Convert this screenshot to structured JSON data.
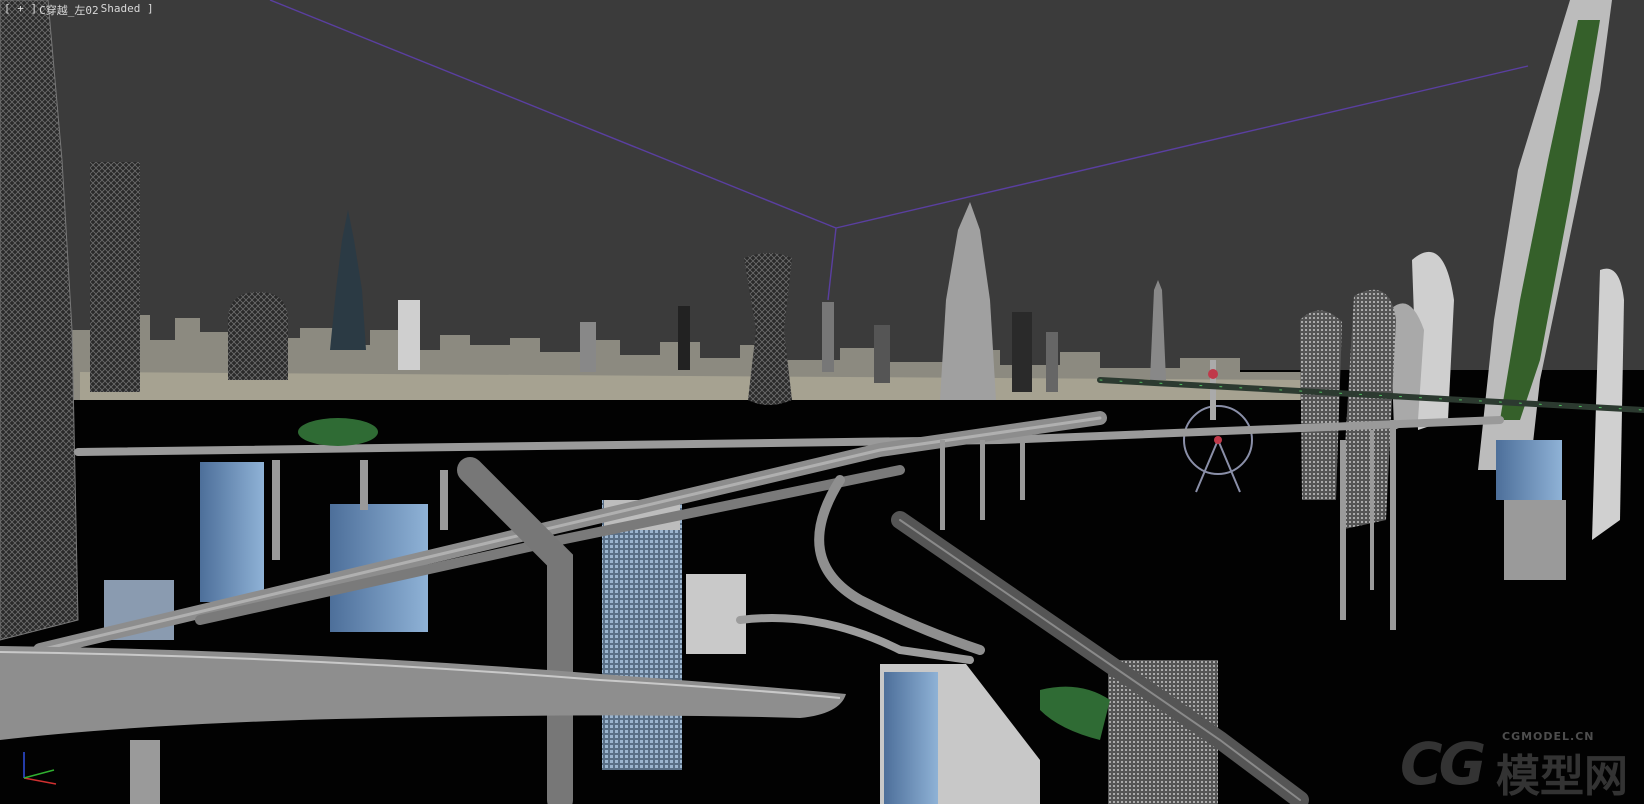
{
  "viewport": {
    "label_open": "[ + ]",
    "camera_label": "C穿越_左02",
    "shading_label": "Shaded ]",
    "background_color": "#3a3a3a",
    "ground_color": "#000000",
    "frame_line_color": "#5a3fa0"
  },
  "gizmo": {
    "axes": [
      "x",
      "y",
      "z"
    ],
    "colors": {
      "x": "#d03030",
      "y": "#30b030",
      "z": "#3050e0"
    }
  },
  "watermark": {
    "logo": "CG",
    "text": "模型网",
    "url": "CGMODEL.CN"
  },
  "icons": [
    "axis-gizmo-icon",
    "watermark-logo-icon"
  ]
}
